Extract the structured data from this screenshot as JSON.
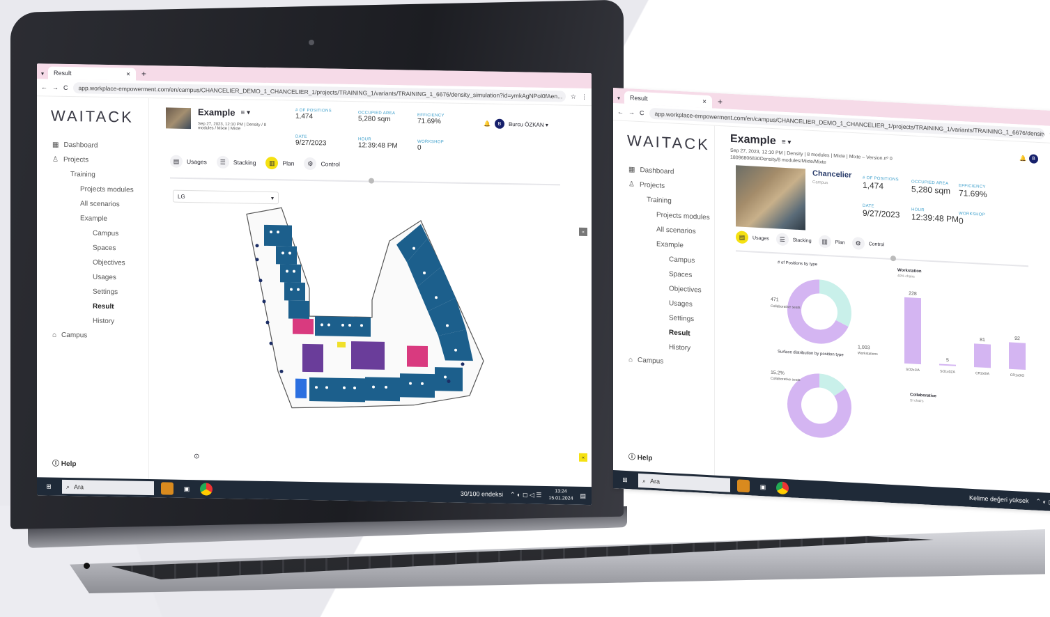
{
  "browser": {
    "tab_title": "Result",
    "tab_close": "×",
    "new_tab": "+",
    "url": "app.workplace-empowerment.com/en/campus/CHANCELIER_DEMO_1_CHANCELIER_1/projects/TRAINING_1/variants/TRAINING_1_6676/density_simulation?id=ymkAgNPol0fAen...",
    "url2": "app.workplace-empowerment.com/en/campus/CHANCELIER_DEMO_1_CHANCELIER_1/projects/TRAINING_1/variants/TRAINING_1_6676/density_simulation?id=ymkAgNPol0fAen..."
  },
  "sidebar": {
    "logo": "WAITACK",
    "items": [
      {
        "label": "Dashboard"
      },
      {
        "label": "Projects"
      },
      {
        "label": "Training"
      },
      {
        "label": "Projects modules"
      },
      {
        "label": "All scenarios"
      },
      {
        "label": "Example"
      },
      {
        "label": "Campus"
      },
      {
        "label": "Spaces"
      },
      {
        "label": "Objectives"
      },
      {
        "label": "Usages"
      },
      {
        "label": "Settings"
      },
      {
        "label": "Result"
      },
      {
        "label": "History"
      },
      {
        "label": "Campus"
      }
    ],
    "help": "Help"
  },
  "header": {
    "title": "Example",
    "menu_icon": "≡ ▾",
    "subtitle": "Sep 27, 2023, 12:10 PM | Density / 8 modules / Mixte | Mixte",
    "subtitle2": "Sep 27, 2023, 12:10 PM | Density | 8 modules | Mixte | Mixte – Version.nº 0",
    "subtitle3": "18096806830Density/8 modules/Mixte/Mixte",
    "stats": [
      {
        "label": "# of positions",
        "value": "1,474"
      },
      {
        "label": "Occupied area",
        "value": "5,280 sqm"
      },
      {
        "label": "Efficiency",
        "value": "71.69%"
      },
      {
        "label": "Date",
        "value": "9/27/2023"
      },
      {
        "label": "Hour",
        "value": "12:39:48 PM"
      },
      {
        "label": "Workshop",
        "value": "0"
      }
    ],
    "user_initial": "B",
    "user_name": "Burcu ÖZKAN ▾",
    "building_name": "Chancelier",
    "building_sub": "Campus"
  },
  "tabs": [
    {
      "label": "Usages"
    },
    {
      "label": "Stacking"
    },
    {
      "label": "Plan"
    },
    {
      "label": "Control"
    }
  ],
  "plan": {
    "floor_select": "LG"
  },
  "chart_data": [
    {
      "type": "pie",
      "title": "# of Positions by type",
      "categories": [
        "Collaborative seats",
        "Workstations"
      ],
      "values": [
        471,
        1003
      ],
      "value_labels": [
        "471",
        "1,003"
      ],
      "colors": [
        "#c9f0ea",
        "#d4b5f2"
      ]
    },
    {
      "type": "bar",
      "title": "Workstation",
      "subtitle": "40% chairs",
      "categories": [
        "SO2x1IA",
        "SO1x0ZA",
        "CR2x0IA",
        "CR1x0IO"
      ],
      "values": [
        228,
        5,
        81,
        92
      ],
      "colors": [
        "#d4b5f2"
      ]
    },
    {
      "type": "pie",
      "title": "Surface distribution by position type",
      "categories": [
        "Collaborative seats",
        "Workstations"
      ],
      "values": [
        15.2,
        84.8
      ],
      "value_labels": [
        "15.2%"
      ],
      "colors": [
        "#c9f0ea",
        "#d4b5f2"
      ]
    }
  ],
  "collab": {
    "title": "Collaborative",
    "sub": "SI chairs"
  },
  "taskbar": {
    "search": "Ara",
    "weather": "30/100 endeksi",
    "weather2": "Kelime değeri yüksek",
    "time": "13:24",
    "date": "15.01.2024"
  }
}
